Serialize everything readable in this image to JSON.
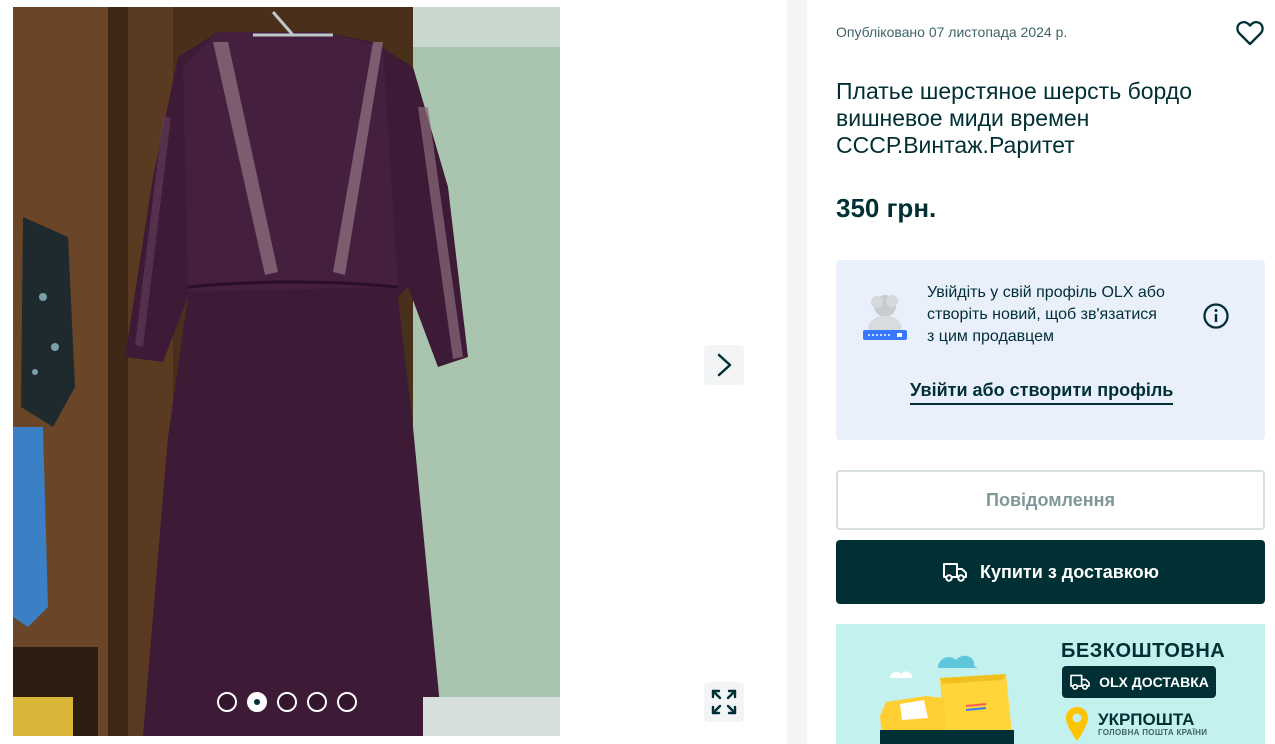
{
  "gallery": {
    "photo_alt": "",
    "slides_total": 5,
    "active_slide": 2,
    "next_icon": "chevron-right-icon",
    "expand_icon": "expand-icon"
  },
  "ad": {
    "published": "Опубліковано 07 листопада 2024 р.",
    "title": "Платье шерстяное шерсть бордо вишневое миди времен СССР.Винтаж.Раритет",
    "price": "350 грн."
  },
  "login_prompt": {
    "text": "Увійдіть у свій профіль OLX або створіть новий, щоб зв'язатися з цим продавцем",
    "link": "Увійти або створити профіль",
    "info_icon": "info-icon"
  },
  "actions": {
    "message": "Повідомлення",
    "buy": "Купити з доставкою",
    "buy_icon": "truck-icon"
  },
  "banner": {
    "free": "БЕЗКОШТОВНА",
    "delivery": "OLX ДОСТАВКА",
    "ukrposhta": "УКРПОШТА",
    "ukrposhta_sub": "ГОЛОВНА ПОШТА КРАЇНИ"
  },
  "colors": {
    "brand_dark": "#002f34",
    "login_bg": "#e9f0fb",
    "banner_bg": "#c3f2ee",
    "truck_yellow": "#ffce32"
  }
}
